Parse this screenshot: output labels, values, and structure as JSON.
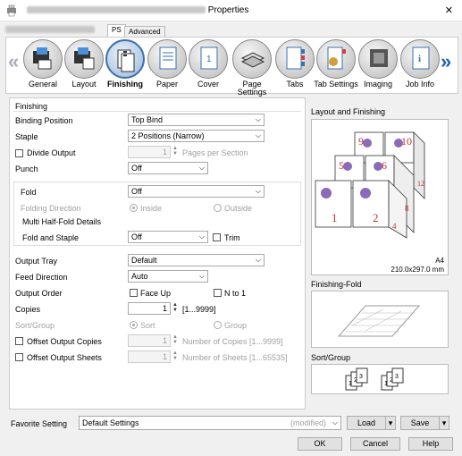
{
  "window": {
    "title": "Properties",
    "close": "✕"
  },
  "tabs": [
    {
      "label": "PS"
    },
    {
      "label": "Advanced"
    }
  ],
  "toolbar": [
    {
      "label": "General"
    },
    {
      "label": "Layout"
    },
    {
      "label": "Finishing"
    },
    {
      "label": "Paper"
    },
    {
      "label": "Cover"
    },
    {
      "label": "Page Settings"
    },
    {
      "label": "Tabs"
    },
    {
      "label": "Tab Settings"
    },
    {
      "label": "Imaging"
    },
    {
      "label": "Job Info"
    }
  ],
  "finishing": {
    "section_title": "Finishing",
    "binding_position": {
      "label": "Binding Position",
      "value": "Top Bind"
    },
    "staple": {
      "label": "Staple",
      "value": "2 Positions (Narrow)"
    },
    "divide_output": {
      "label": "Divide Output",
      "value": "1",
      "unit": "Pages per Section"
    },
    "punch": {
      "label": "Punch",
      "value": "Off"
    },
    "fold": {
      "label": "Fold",
      "value": "Off"
    },
    "folding_direction": {
      "label": "Folding Direction",
      "inside": "Inside",
      "outside": "Outside"
    },
    "multi_half_fold": {
      "label": "Multi Half-Fold Details"
    },
    "fold_and_staple": {
      "label": "Fold and Staple",
      "value": "Off",
      "trim": "Trim"
    },
    "output_tray": {
      "label": "Output Tray",
      "value": "Default"
    },
    "feed_direction": {
      "label": "Feed Direction",
      "value": "Auto"
    },
    "output_order": {
      "label": "Output Order",
      "face_up": "Face Up",
      "n_to_1": "N to 1"
    },
    "copies": {
      "label": "Copies",
      "value": "1",
      "range": "[1...9999]"
    },
    "sort_group": {
      "label": "Sort/Group",
      "sort": "Sort",
      "group": "Group"
    },
    "offset_copies": {
      "label": "Offset Output Copies",
      "value": "1",
      "unit": "Number of Copies [1...9999]"
    },
    "offset_sheets": {
      "label": "Offset Output Sheets",
      "value": "1",
      "unit": "Number of Sheets [1...65535]"
    }
  },
  "preview": {
    "layout_title": "Layout and Finishing",
    "page_numbers": [
      "9",
      "10",
      "5",
      "6",
      "1",
      "2",
      "12",
      "8",
      "4"
    ],
    "paper_size": "A4",
    "paper_dims": "210.0x297.0 mm",
    "fold_title": "Finishing-Fold",
    "sort_title": "Sort/Group",
    "sort_pages": [
      "1",
      "2",
      "3",
      "1",
      "2",
      "3"
    ]
  },
  "favorite": {
    "label": "Favorite Setting",
    "value": "Default Settings",
    "modified": "(modified)",
    "load": "Load",
    "save": "Save"
  },
  "footer": {
    "ok": "OK",
    "cancel": "Cancel",
    "help": "Help"
  }
}
